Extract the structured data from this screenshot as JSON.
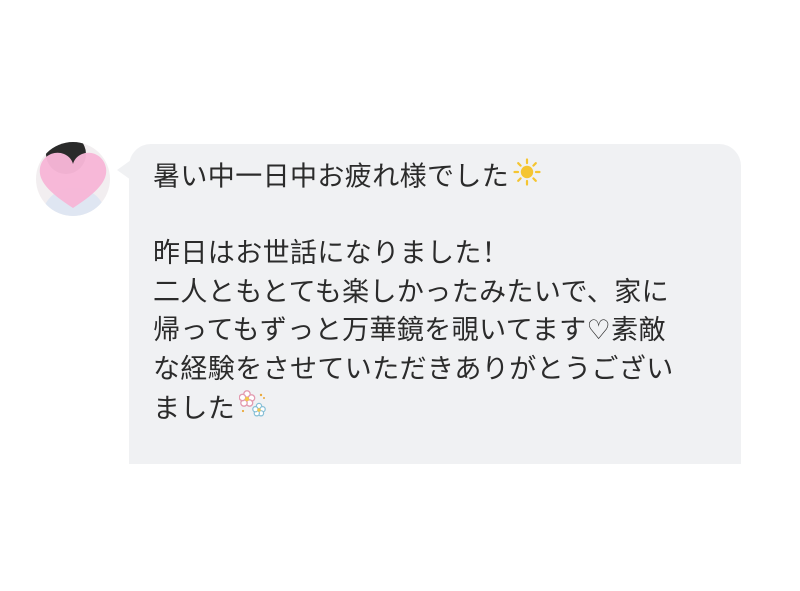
{
  "message": {
    "line1": "暑い中一日中お疲れ様でした",
    "line1_icon": "sun-icon",
    "line2": "昨日はお世話になりました！",
    "line3": "二人ともとても楽しかったみたいで、家に",
    "line4": "帰ってもずっと万華鏡を覗いてます♡素敵",
    "line5": "な経験をさせていただきありがとうござい",
    "line6": "ました",
    "line6_icon": "flowers-icon"
  },
  "avatar": {
    "icon": "pink-heart-icon",
    "overlay_color": "#f7b6d7"
  },
  "colors": {
    "bubble": "#f0f1f3",
    "text": "#2b2b2b",
    "sun": "#f5c531"
  }
}
